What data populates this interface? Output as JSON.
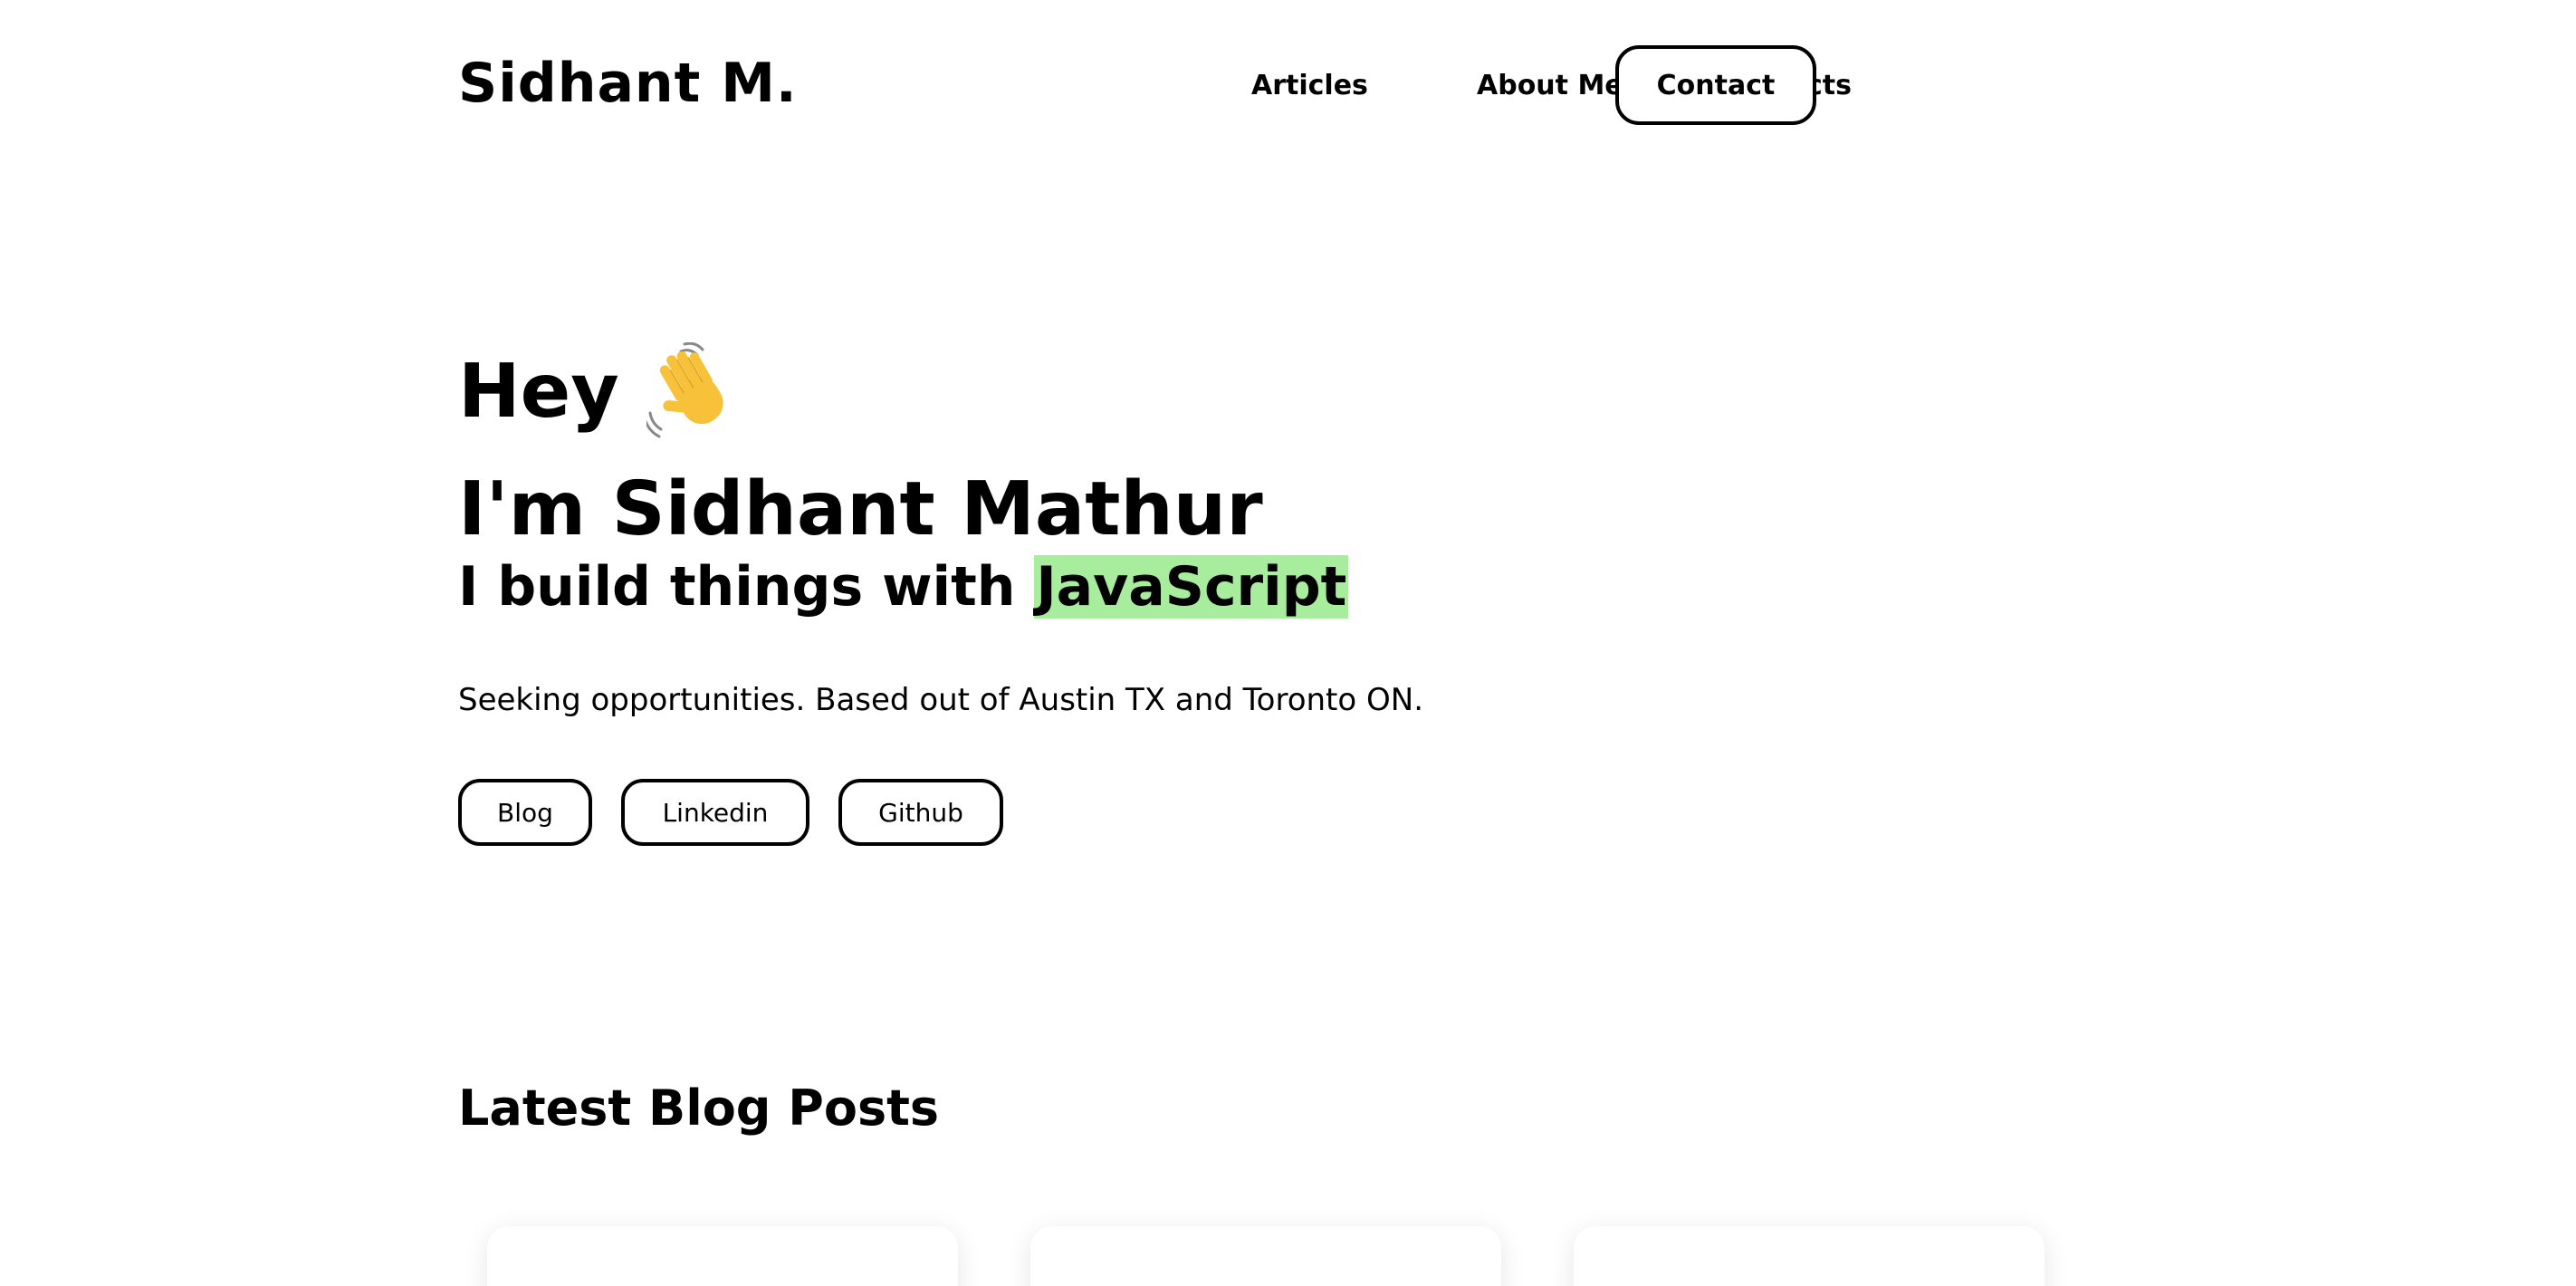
{
  "header": {
    "brand": "Sidhant M.",
    "nav": [
      {
        "label": "Articles"
      },
      {
        "label": "About Me"
      },
      {
        "label": "Projects"
      }
    ],
    "contact_label": "Contact"
  },
  "hero": {
    "greeting": "Hey",
    "greeting_icon": "waving-hand-icon",
    "name_line": "I'm Sidhant Mathur",
    "tagline_prefix": "I build things with",
    "tagline_highlight": "JavaScript",
    "highlight_color": "#a8ec9e",
    "subtitle": "Seeking opportunities. Based out of Austin TX and Toronto ON.",
    "links": [
      {
        "label": "Blog"
      },
      {
        "label": "Linkedin"
      },
      {
        "label": "Github"
      }
    ]
  },
  "blog": {
    "title": "Latest Blog Posts"
  }
}
